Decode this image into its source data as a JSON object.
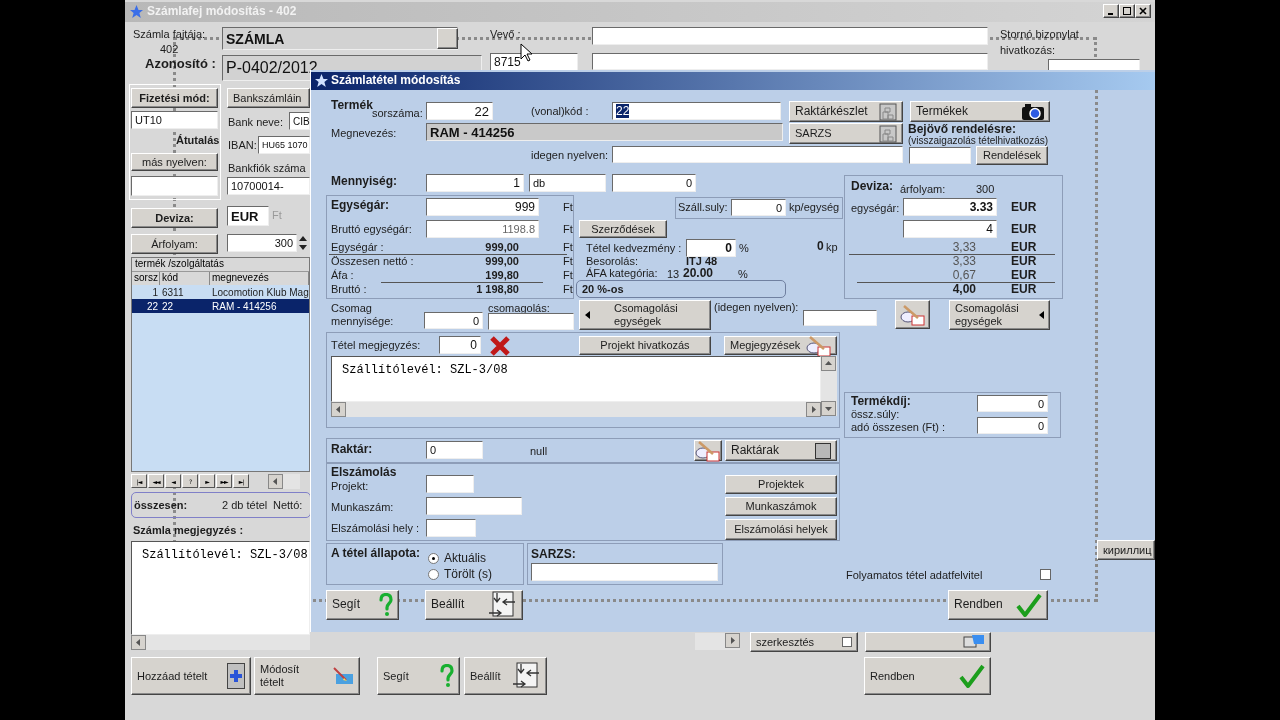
{
  "main": {
    "title": "Számlafej módosítás - 402",
    "type_label": "Számla fajtája:",
    "type_number": "402",
    "type_value": "SZÁMLA",
    "customer_label": "Vevő :",
    "customer_code": "8715",
    "storno_label": "Stornó bizonylat",
    "storno_ref_label": "hivatkozás:",
    "id_label": "Azonosító :",
    "id_value": "P-0402/2012",
    "payment_button": "Fizetési mód:",
    "payment_code": "UT10",
    "payment_name": "Átutalás",
    "other_lang_button": "más nyelven:",
    "bank_button": "Bankszámláin",
    "bank_name_label": "Bank neve:",
    "bank_name": "CIB",
    "iban_label": "IBAN:",
    "iban": "HU65 1070",
    "branch_label": "Bankfiók száma",
    "branch": "10700014-",
    "currency_button": "Deviza:",
    "currency": "EUR",
    "currency_base": "Ft",
    "rate_button": "Árfolyam:",
    "rate": "300",
    "table": {
      "title": "termék /szolgáltatás",
      "columns": [
        "sorsz",
        "kód",
        "megnevezés"
      ],
      "rows": [
        {
          "cells": [
            "1",
            "6311",
            "Locomotion Klub Mag"
          ],
          "selected": false
        },
        {
          "cells": [
            "22",
            "22",
            "RAM - 414256"
          ],
          "selected": true
        }
      ]
    },
    "nav_buttons": [
      "|◄",
      "◄◄",
      "◄",
      "?",
      "►",
      "►►",
      "►|"
    ],
    "total_label": "összesen:",
    "total_count": "2 db tétel",
    "total_net_label": "Nettó:",
    "note_label": "Számla megjegyzés :",
    "note": "Szállítólevél: SZL-3/08",
    "edit_button": {
      "label": "szerkesztés",
      "checked": false
    },
    "ok_button": {
      "label": "Rendben",
      "kind": "ok"
    },
    "cyrillic_button": "кириллиц",
    "bottom_buttons": [
      {
        "label": "Hozzáad tételt",
        "kind": "plus"
      },
      {
        "label": "Módosít tételt",
        "kind": "edit"
      },
      {
        "label": "Segít",
        "kind": "help"
      },
      {
        "label": "Beállít",
        "kind": "settings"
      }
    ]
  },
  "dialog": {
    "title": "Számlatétel módosítás",
    "product_label": "Termék",
    "serial_label": "sorszáma:",
    "serial": "22",
    "barcode_label": "(vonal)kód :",
    "barcode": {
      "value": "22",
      "highlighted": true
    },
    "stock_button": "Raktárkészlet",
    "products_button": "Termékek",
    "name_label": "Megnevezés:",
    "name": "RAM - 414256",
    "batch_button": "SARZS",
    "incoming_label": "Bejövő rendelésre:",
    "incoming_hint": "(visszaigazolás tételhivatkozás)",
    "orders_button": "Rendelések",
    "foreign_label": "idegen nyelven:",
    "quantity_label": "Mennyiség:",
    "quantity": "1",
    "unit": "db",
    "quantity_2": "0",
    "price": {
      "unit_price_label": "Egységár:",
      "unit_price": "999",
      "unit_price_currency": "Ft",
      "gross_unit_label": "Bruttó egységár:",
      "gross_unit": "1198.8",
      "gross_unit_currency": "Ft",
      "summary": [
        {
          "label": "Egységár :",
          "value": "999,00",
          "currency": "Ft"
        },
        {
          "label": "Összesen nettó :",
          "value": "999,00",
          "currency": "Ft"
        },
        {
          "label": "Áfa :",
          "value": "199,80",
          "currency": "Ft"
        },
        {
          "label": "Bruttó :",
          "value": "1 198,80",
          "currency": "Ft"
        }
      ]
    },
    "weight_label": "Száll.suly:",
    "weight": "0",
    "weight_unit": "kp/egység",
    "contracts_button": "Szerződések",
    "discount_label": "Tétel kedvezmény :",
    "discount": "0",
    "discount_unit": "%",
    "total_weight": "0",
    "total_weight_unit": "kp",
    "class_label": "Besorolás:",
    "class": "ITJ 48",
    "vat_label": "ÁFA kategória:",
    "vat_code": "13",
    "vat_rate": "20.00",
    "vat_unit": "%",
    "vat_name": "20 %-os",
    "fx": {
      "label": "Deviza:",
      "rate_label": "árfolyam:",
      "rate": "300",
      "unit_price_label": "egységár:",
      "inputs": [
        {
          "value": "3.33",
          "currency": "EUR"
        },
        {
          "value": "4",
          "currency": "EUR"
        }
      ],
      "totals": [
        {
          "value": "3,33",
          "currency": "EUR",
          "bold": false
        },
        {
          "value": "3,33",
          "currency": "EUR",
          "bold": false
        },
        {
          "value": "0,67",
          "currency": "EUR",
          "bold": false
        },
        {
          "value": "4,00",
          "currency": "EUR",
          "bold": true
        }
      ]
    },
    "pack_qty_label": "Csomag mennyisége:",
    "pack_qty": "0",
    "packaging_label": "csomagolás:",
    "pack_units_button": "Csomagolási egységek",
    "foreign2_label": "(idegen nyelven):",
    "pack_units_button_2": "Csomagolási egységek",
    "note_label": "Tétel megjegyzés:",
    "note_count": "0",
    "project_ref_button": "Projekt hivatkozás",
    "notes_button": "Megjegyzések",
    "note": "Szállítólevél: SZL-3/08",
    "fee": {
      "label": "Termékdíj:",
      "weight_label": "össz.súly:",
      "tax_label": "adó összesen (Ft) :",
      "weight": "0",
      "tax": "0"
    },
    "warehouse_label": "Raktár:",
    "warehouse": "0",
    "warehouse_name": "null",
    "warehouses_button": "Raktárak",
    "accounting": {
      "label": "Elszámolás",
      "project_label": "Projekt:",
      "job_label": "Munkaszám:",
      "place_label": "Elszámolási hely :",
      "projects_button": "Projektek",
      "jobs_button": "Munkaszámok",
      "places_button": "Elszámolási helyek"
    },
    "status": {
      "label": "A tétel állapota:",
      "options": [
        {
          "label": "Aktuális",
          "selected": true
        },
        {
          "label": "Törölt (s)",
          "selected": false
        }
      ]
    },
    "batch_label": "SARZS:",
    "continuous": {
      "label": "Folyamatos tétel adatfelvitel",
      "checked": false
    },
    "buttons": [
      {
        "label": "Segít",
        "kind": "help"
      },
      {
        "label": "Beállít",
        "kind": "settings"
      },
      {
        "label": "Rendben",
        "kind": "ok"
      }
    ]
  }
}
